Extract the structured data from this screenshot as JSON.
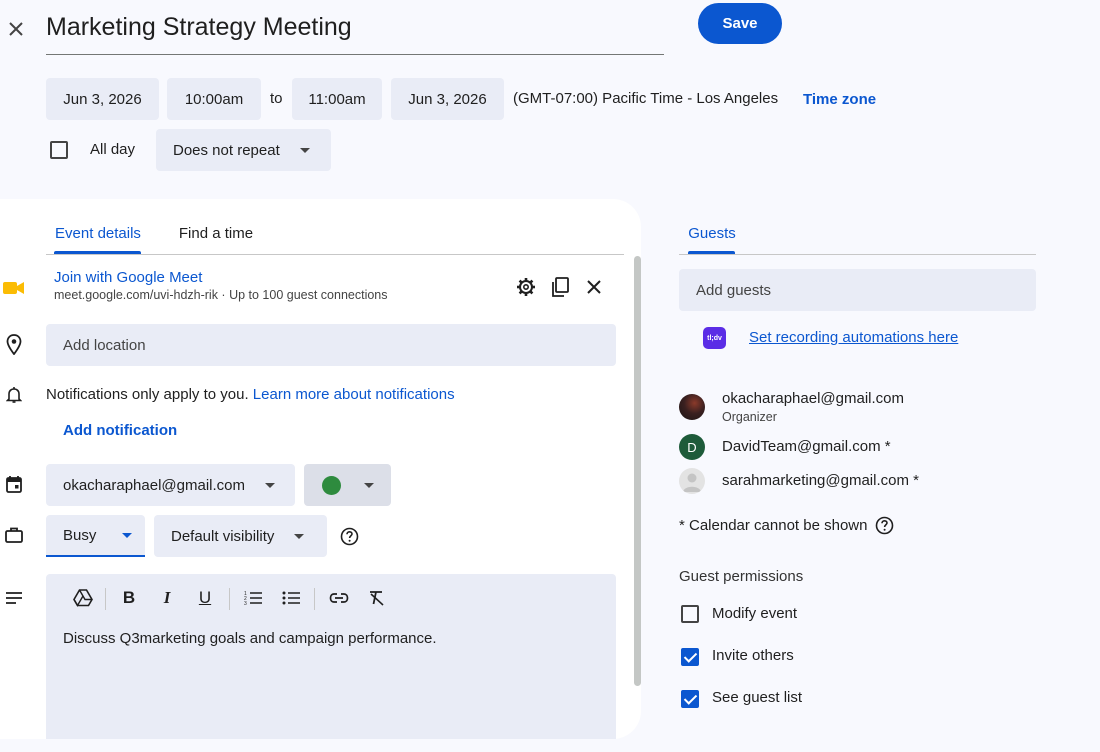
{
  "header": {
    "title": "Marketing Strategy Meeting",
    "save_label": "Save"
  },
  "datetime": {
    "start_date": "Jun 3, 2026",
    "start_time": "10:00am",
    "to_label": "to",
    "end_time": "11:00am",
    "end_date": "Jun 3, 2026",
    "timezone_text": "(GMT-07:00) Pacific Time - Los Angeles",
    "timezone_link": "Time zone",
    "all_day_label": "All day",
    "repeat_value": "Does not repeat"
  },
  "tabs": {
    "event_details": "Event details",
    "find_time": "Find a time"
  },
  "meet": {
    "join_label": "Join with Google Meet",
    "subtext": "meet.google.com/uvi-hdzh-rik · Up to 100 guest connections"
  },
  "location": {
    "placeholder": "Add location"
  },
  "notifications": {
    "info": "Notifications only apply to you.",
    "learn_more": "Learn more about notifications",
    "add_label": "Add notification"
  },
  "calendar": {
    "owner": "okacharaphael@gmail.com",
    "color": "#2e8b3e"
  },
  "availability": {
    "status": "Busy",
    "visibility": "Default visibility"
  },
  "description": {
    "text": "Discuss Q3marketing goals and campaign performance."
  },
  "guests": {
    "tab_label": "Guests",
    "add_placeholder": "Add guests",
    "recording_logo": "tl;dv",
    "recording_link": "Set recording automations here",
    "list": [
      {
        "email": "okacharaphael@gmail.com",
        "role": "Organizer",
        "avatar": ""
      },
      {
        "email": "DavidTeam@gmail.com *",
        "role": "",
        "avatar": "D"
      },
      {
        "email": "sarahmarketing@gmail.com *",
        "role": "",
        "avatar": ""
      }
    ],
    "calendar_note": "* Calendar cannot be shown",
    "permissions_title": "Guest permissions",
    "permissions": [
      {
        "label": "Modify event",
        "checked": false
      },
      {
        "label": "Invite others",
        "checked": true
      },
      {
        "label": "See guest list",
        "checked": true
      }
    ]
  },
  "colors": {
    "accent": "#0b57d0",
    "chip_bg": "#e9ecf6",
    "page_bg": "#f8f9fe",
    "david_avatar": "#1e5b3a"
  }
}
